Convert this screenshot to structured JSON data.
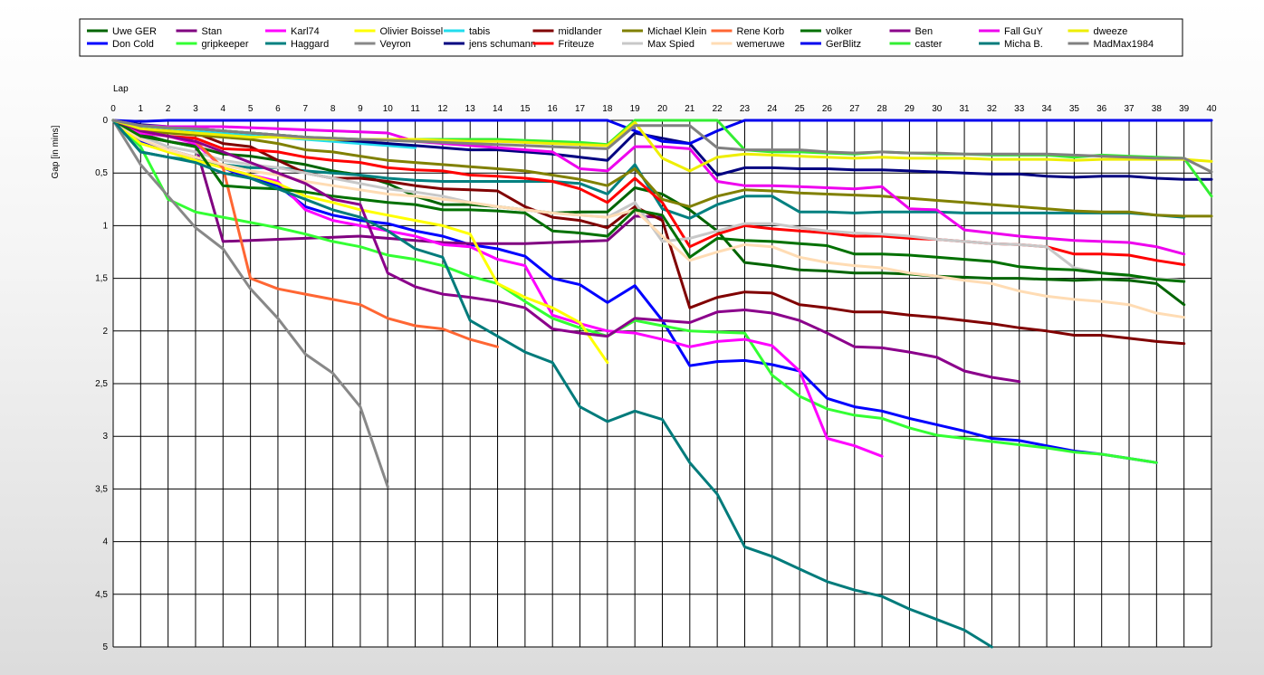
{
  "chart_data": {
    "type": "line",
    "xlabel": "Lap",
    "ylabel": "Gap [in mins]",
    "xlim": [
      0,
      40
    ],
    "ylim": [
      0,
      5
    ],
    "y_inverted": true,
    "grid": true,
    "legend_position": "top",
    "x_ticks": [
      "0",
      "1",
      "2",
      "3",
      "4",
      "5",
      "6",
      "7",
      "8",
      "9",
      "10",
      "11",
      "12",
      "13",
      "14",
      "15",
      "16",
      "17",
      "18",
      "19",
      "20",
      "21",
      "22",
      "23",
      "24",
      "25",
      "26",
      "27",
      "28",
      "29",
      "30",
      "31",
      "32",
      "33",
      "34",
      "35",
      "36",
      "37",
      "38",
      "39",
      "40"
    ],
    "y_ticks": [
      "0",
      "0,5",
      "1",
      "1,5",
      "2",
      "2,5",
      "3",
      "3,5",
      "4",
      "4,5",
      "5"
    ],
    "series": [
      {
        "name": "Uwe GER",
        "color": "#006400",
        "values": [
          0,
          0.13,
          0.2,
          0.25,
          0.32,
          0.34,
          0.38,
          0.42,
          0.48,
          0.52,
          0.6,
          0.72,
          0.8,
          0.8,
          0.82,
          0.85,
          0.88,
          0.87,
          0.87,
          0.64,
          0.7,
          0.85,
          1.05,
          1.35,
          1.38,
          1.42,
          1.43,
          1.45,
          1.45,
          1.46,
          1.48,
          1.49,
          1.5,
          1.5,
          1.51,
          1.52,
          1.51,
          1.52,
          1.55,
          1.75
        ]
      },
      {
        "name": "Don Cold",
        "color": "#0000ff",
        "values": [
          0,
          0.2,
          0.28,
          0.35,
          0.45,
          0.55,
          0.62,
          0.82,
          0.9,
          0.95,
          0.98,
          1.05,
          1.1,
          1.18,
          1.22,
          1.29,
          1.5,
          1.56,
          1.73,
          1.57,
          1.9,
          2.33,
          2.29,
          2.28,
          2.32,
          2.38,
          2.64,
          2.72,
          2.76,
          2.83,
          2.89,
          2.95,
          3.02,
          3.04,
          3.09,
          3.14,
          3.17,
          3.21,
          3.25
        ]
      },
      {
        "name": "Stan",
        "color": "#800080",
        "values": [
          0,
          0.15,
          0.2,
          0.24,
          1.15,
          1.14,
          1.13,
          1.12,
          1.11,
          1.1,
          1.12,
          1.14,
          1.16,
          1.17,
          1.17,
          1.17,
          1.16,
          1.15,
          1.14,
          0.91,
          0.92
        ]
      },
      {
        "name": "gripkeeper",
        "color": "#33ff33",
        "values": [
          0,
          0.25,
          0.75,
          0.87,
          0.92,
          0.97,
          1.02,
          1.08,
          1.15,
          1.2,
          1.28,
          1.32,
          1.38,
          1.48,
          1.55,
          1.72,
          1.88,
          1.97,
          2.05,
          1.9,
          1.95,
          2.0,
          2.01,
          2.02,
          2.42,
          2.62,
          2.74,
          2.8,
          2.83,
          2.92,
          2.99,
          3.02,
          3.05,
          3.08,
          3.11,
          3.15,
          3.17,
          3.21,
          3.25
        ]
      },
      {
        "name": "Karl74",
        "color": "#ff00ff",
        "values": [
          0,
          0.12,
          0.15,
          0.22,
          0.45,
          0.52,
          0.58,
          0.85,
          0.95,
          1.0,
          1.05,
          1.1,
          1.18,
          1.2,
          1.32,
          1.38,
          1.85,
          1.93,
          2.0,
          2.02,
          2.08,
          2.15,
          2.1,
          2.08,
          2.14,
          2.38,
          3.02,
          3.09,
          3.19
        ]
      },
      {
        "name": "Haggard",
        "color": "#008080",
        "values": [
          0,
          0.3,
          0.35,
          0.38,
          0.42,
          0.45,
          0.45,
          0.48,
          0.5,
          0.52,
          0.55,
          0.57,
          0.58,
          0.58,
          0.58,
          0.58,
          0.58,
          0.6,
          0.7,
          0.42,
          0.84,
          0.93,
          0.8,
          0.72,
          0.72,
          0.87,
          0.87,
          0.88,
          0.87,
          0.87,
          0.87,
          0.88,
          0.88,
          0.88,
          0.88,
          0.88,
          0.88,
          0.88,
          0.9,
          0.92
        ]
      },
      {
        "name": "Olivier Boissel",
        "color": "#ffff00",
        "values": [
          0,
          0.22,
          0.3,
          0.38,
          0.45,
          0.52,
          0.6,
          0.72,
          0.78,
          0.85,
          0.9,
          0.95,
          1.0,
          1.08,
          1.55,
          1.68,
          1.78,
          1.92,
          2.3
        ]
      },
      {
        "name": "Veyron",
        "color": "#888888",
        "values": [
          0,
          0.42,
          0.72,
          1.02,
          1.22,
          1.6,
          1.88,
          2.22,
          2.4,
          2.72,
          3.48
        ]
      },
      {
        "name": "tabis",
        "color": "#22ddee",
        "values": [
          0,
          0.06,
          0.08,
          0.1,
          0.12,
          0.14,
          0.16,
          0.18,
          0.2,
          0.22,
          0.24,
          0.26
        ]
      },
      {
        "name": "jens  schumann",
        "color": "#000080",
        "values": [
          0,
          0.04,
          0.06,
          0.08,
          0.1,
          0.12,
          0.14,
          0.16,
          0.18,
          0.2,
          0.22,
          0.24,
          0.26,
          0.28,
          0.28,
          0.3,
          0.32,
          0.35,
          0.38,
          0.12,
          0.17,
          0.22,
          0.52,
          0.45,
          0.45,
          0.46,
          0.46,
          0.47,
          0.47,
          0.48,
          0.49,
          0.5,
          0.51,
          0.51,
          0.53,
          0.54,
          0.53,
          0.53,
          0.55,
          0.56,
          0.56
        ]
      },
      {
        "name": "midlander",
        "color": "#800000",
        "values": [
          0,
          0.08,
          0.1,
          0.12,
          0.22,
          0.25,
          0.38,
          0.5,
          0.55,
          0.55,
          0.58,
          0.62,
          0.65,
          0.66,
          0.67,
          0.82,
          0.92,
          0.95,
          1.02,
          0.82,
          0.95,
          1.78,
          1.68,
          1.63,
          1.64,
          1.75,
          1.78,
          1.82,
          1.82,
          1.85,
          1.87,
          1.9,
          1.93,
          1.97,
          2.0,
          2.04,
          2.04,
          2.07,
          2.1,
          2.12
        ]
      },
      {
        "name": "Friteuze",
        "color": "#ff0000",
        "values": [
          0,
          0.1,
          0.15,
          0.17,
          0.27,
          0.28,
          0.3,
          0.35,
          0.38,
          0.4,
          0.45,
          0.47,
          0.48,
          0.52,
          0.53,
          0.55,
          0.58,
          0.65,
          0.78,
          0.55,
          0.78,
          1.2,
          1.08,
          1.0,
          1.03,
          1.05,
          1.07,
          1.1,
          1.1,
          1.12,
          1.13,
          1.15,
          1.17,
          1.18,
          1.2,
          1.27,
          1.27,
          1.28,
          1.33,
          1.37
        ]
      },
      {
        "name": "Michael Klein",
        "color": "#808000",
        "values": [
          0,
          0.1,
          0.12,
          0.14,
          0.16,
          0.18,
          0.22,
          0.28,
          0.3,
          0.34,
          0.38,
          0.4,
          0.42,
          0.44,
          0.46,
          0.48,
          0.52,
          0.56,
          0.62,
          0.46,
          0.75,
          0.82,
          0.72,
          0.66,
          0.67,
          0.69,
          0.7,
          0.71,
          0.72,
          0.74,
          0.76,
          0.78,
          0.8,
          0.82,
          0.84,
          0.86,
          0.87,
          0.87,
          0.9,
          0.91,
          0.91
        ]
      },
      {
        "name": "Max Spied",
        "color": "#c8c8c8",
        "values": [
          0,
          0.15,
          0.25,
          0.3,
          0.38,
          0.42,
          0.45,
          0.5,
          0.55,
          0.6,
          0.65,
          0.68,
          0.72,
          0.78,
          0.82,
          0.85,
          0.88,
          0.9,
          0.92,
          0.78,
          1.15,
          1.12,
          1.05,
          0.98,
          0.98,
          1.02,
          1.05,
          1.07,
          1.08,
          1.1,
          1.13,
          1.15,
          1.17,
          1.18,
          1.2,
          1.4,
          1.45,
          1.48,
          1.5,
          1.52
        ]
      },
      {
        "name": "Rene Korb",
        "color": "#ff6633",
        "values": [
          0,
          0.1,
          0.15,
          0.2,
          0.45,
          1.5,
          1.6,
          1.65,
          1.7,
          1.75,
          1.88,
          1.95,
          1.98,
          2.08,
          2.15
        ]
      },
      {
        "name": "wemeruwe",
        "color": "#ffdcb4",
        "values": [
          0,
          0.18,
          0.28,
          0.35,
          0.42,
          0.48,
          0.52,
          0.58,
          0.62,
          0.66,
          0.7,
          0.72,
          0.75,
          0.78,
          0.82,
          0.85,
          0.88,
          0.9,
          0.92,
          0.85,
          1.1,
          1.33,
          1.25,
          1.18,
          1.2,
          1.3,
          1.35,
          1.38,
          1.4,
          1.45,
          1.48,
          1.52,
          1.55,
          1.62,
          1.67,
          1.7,
          1.72,
          1.75,
          1.83,
          1.87
        ]
      },
      {
        "name": "volker",
        "color": "#007000",
        "values": [
          0,
          0.15,
          0.2,
          0.25,
          0.62,
          0.64,
          0.65,
          0.68,
          0.72,
          0.75,
          0.78,
          0.8,
          0.85,
          0.85,
          0.86,
          0.88,
          1.05,
          1.07,
          1.1,
          0.85,
          0.9,
          1.3,
          1.12,
          1.14,
          1.15,
          1.17,
          1.19,
          1.27,
          1.27,
          1.28,
          1.3,
          1.32,
          1.34,
          1.39,
          1.41,
          1.42,
          1.45,
          1.47,
          1.51,
          1.53
        ]
      },
      {
        "name": "GerBlitz",
        "color": "#0000ee",
        "values": [
          0,
          0.01,
          0,
          0,
          0,
          0,
          0,
          0,
          0,
          0,
          0,
          0,
          0,
          0,
          0,
          0,
          0,
          0,
          0,
          0.1,
          0.2,
          0.22,
          0.1,
          0,
          0,
          0,
          0,
          0,
          0,
          0,
          0,
          0,
          0,
          0,
          0,
          0,
          0,
          0,
          0,
          0,
          0
        ]
      },
      {
        "name": "Ben",
        "color": "#8b008b",
        "values": [
          0,
          0.1,
          0.15,
          0.2,
          0.3,
          0.4,
          0.5,
          0.6,
          0.75,
          0.8,
          1.45,
          1.58,
          1.65,
          1.68,
          1.72,
          1.78,
          1.98,
          2.02,
          2.05,
          1.88,
          1.9,
          1.92,
          1.82,
          1.8,
          1.83,
          1.9,
          2.02,
          2.15,
          2.16,
          2.2,
          2.25,
          2.38,
          2.44,
          2.48
        ]
      },
      {
        "name": "caster",
        "color": "#33ee33",
        "values": [
          0,
          0.05,
          0.07,
          0.08,
          0.1,
          0.12,
          0.14,
          0.16,
          0.17,
          0.18,
          0.18,
          0.18,
          0.18,
          0.18,
          0.18,
          0.19,
          0.2,
          0.21,
          0.23,
          0,
          0,
          0,
          0,
          0.28,
          0.3,
          0.3,
          0.31,
          0.32,
          0.3,
          0.31,
          0.32,
          0.32,
          0.33,
          0.33,
          0.33,
          0.35,
          0.33,
          0.34,
          0.35,
          0.36,
          0.72
        ]
      },
      {
        "name": "Fall GuY",
        "color": "#ee00ee",
        "values": [
          0,
          0.05,
          0.06,
          0.06,
          0.06,
          0.07,
          0.08,
          0.09,
          0.1,
          0.11,
          0.12,
          0.2,
          0.22,
          0.24,
          0.26,
          0.28,
          0.3,
          0.46,
          0.48,
          0.25,
          0.25,
          0.27,
          0.58,
          0.62,
          0.62,
          0.63,
          0.64,
          0.65,
          0.63,
          0.84,
          0.85,
          1.04,
          1.07,
          1.1,
          1.12,
          1.14,
          1.15,
          1.16,
          1.2,
          1.27
        ]
      },
      {
        "name": "Micha B.",
        "color": "#007b7b",
        "values": [
          0,
          0.3,
          0.35,
          0.4,
          0.5,
          0.55,
          0.65,
          0.75,
          0.85,
          0.92,
          1.05,
          1.22,
          1.3,
          1.9,
          2.05,
          2.2,
          2.3,
          2.72,
          2.86,
          2.76,
          2.84,
          3.25,
          3.55,
          4.05,
          4.14,
          4.26,
          4.38,
          4.46,
          4.52,
          4.64,
          4.74,
          4.84,
          5.0
        ]
      },
      {
        "name": "dweeze",
        "color": "#eeee00",
        "values": [
          0,
          0.08,
          0.1,
          0.12,
          0.14,
          0.16,
          0.16,
          0.17,
          0.18,
          0.18,
          0.18,
          0.18,
          0.19,
          0.2,
          0.2,
          0.21,
          0.22,
          0.23,
          0.24,
          0.02,
          0.36,
          0.48,
          0.35,
          0.32,
          0.33,
          0.34,
          0.35,
          0.36,
          0.35,
          0.36,
          0.36,
          0.36,
          0.37,
          0.37,
          0.37,
          0.38,
          0.37,
          0.37,
          0.37,
          0.37,
          0.39
        ]
      },
      {
        "name": "MadMax1984",
        "color": "#808080",
        "values": [
          0,
          0.05,
          0.07,
          0.08,
          0.1,
          0.12,
          0.14,
          0.16,
          0.17,
          0.18,
          0.19,
          0.2,
          0.21,
          0.22,
          0.23,
          0.24,
          0.25,
          0.26,
          0.27,
          0.05,
          0.05,
          0.05,
          0.26,
          0.28,
          0.28,
          0.28,
          0.3,
          0.31,
          0.3,
          0.31,
          0.31,
          0.32,
          0.32,
          0.32,
          0.32,
          0.33,
          0.34,
          0.35,
          0.36,
          0.36,
          0.49
        ]
      }
    ]
  }
}
